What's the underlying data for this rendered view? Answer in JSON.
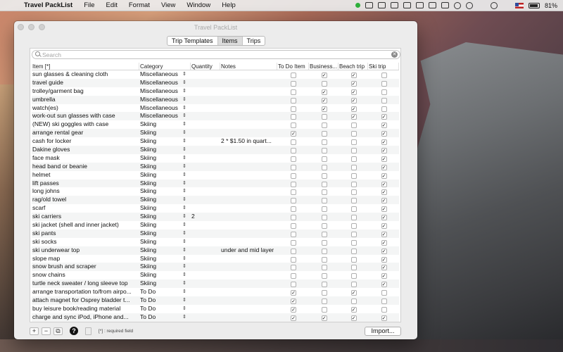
{
  "menubar": {
    "app_name": "Travel PackList",
    "menus": [
      "File",
      "Edit",
      "Format",
      "View",
      "Window",
      "Help"
    ],
    "battery": "81%"
  },
  "window": {
    "title": "Travel PackList",
    "tabs": [
      {
        "label": "Trip Templates",
        "active": false
      },
      {
        "label": "Items",
        "active": true
      },
      {
        "label": "Trips",
        "active": false
      }
    ],
    "search_placeholder": "Search",
    "columns": [
      "Item [*]",
      "Category",
      "Quantity",
      "Notes",
      "To Do Item",
      "Business...",
      "Beach trip",
      "Ski trip"
    ],
    "rows": [
      {
        "item": "sun glasses & cleaning cloth",
        "category": "Miscellaneous",
        "quantity": "",
        "notes": "",
        "todo": false,
        "business": true,
        "beach": true,
        "ski": false
      },
      {
        "item": "travel guide",
        "category": "Miscellaneous",
        "quantity": "",
        "notes": "",
        "todo": false,
        "business": false,
        "beach": true,
        "ski": false
      },
      {
        "item": "trolley/garment bag",
        "category": "Miscellaneous",
        "quantity": "",
        "notes": "",
        "todo": false,
        "business": true,
        "beach": true,
        "ski": false
      },
      {
        "item": "umbrella",
        "category": "Miscellaneous",
        "quantity": "",
        "notes": "",
        "todo": false,
        "business": true,
        "beach": true,
        "ski": false
      },
      {
        "item": "watch(es)",
        "category": "Miscellaneous",
        "quantity": "",
        "notes": "",
        "todo": false,
        "business": true,
        "beach": true,
        "ski": false
      },
      {
        "item": "work-out sun glasses with case",
        "category": "Miscellaneous",
        "quantity": "",
        "notes": "",
        "todo": false,
        "business": false,
        "beach": true,
        "ski": true
      },
      {
        "item": "(NEW) ski goggles with case",
        "category": "Skiing",
        "quantity": "",
        "notes": "",
        "todo": false,
        "business": false,
        "beach": false,
        "ski": true
      },
      {
        "item": "arrange rental gear",
        "category": "Skiing",
        "quantity": "",
        "notes": "",
        "todo": true,
        "business": false,
        "beach": false,
        "ski": true
      },
      {
        "item": "cash for locker",
        "category": "Skiing",
        "quantity": "",
        "notes": "2 * $1.50 in quart...",
        "todo": false,
        "business": false,
        "beach": false,
        "ski": true
      },
      {
        "item": "Dakine gloves",
        "category": "Skiing",
        "quantity": "",
        "notes": "",
        "todo": false,
        "business": false,
        "beach": false,
        "ski": true
      },
      {
        "item": "face mask",
        "category": "Skiing",
        "quantity": "",
        "notes": "",
        "todo": false,
        "business": false,
        "beach": false,
        "ski": true
      },
      {
        "item": "head band or beanie",
        "category": "Skiing",
        "quantity": "",
        "notes": "",
        "todo": false,
        "business": false,
        "beach": false,
        "ski": true
      },
      {
        "item": "helmet",
        "category": "Skiing",
        "quantity": "",
        "notes": "",
        "todo": false,
        "business": false,
        "beach": false,
        "ski": true
      },
      {
        "item": "lift passes",
        "category": "Skiing",
        "quantity": "",
        "notes": "",
        "todo": false,
        "business": false,
        "beach": false,
        "ski": true
      },
      {
        "item": "long johns",
        "category": "Skiing",
        "quantity": "",
        "notes": "",
        "todo": false,
        "business": false,
        "beach": false,
        "ski": true
      },
      {
        "item": "rag/old towel",
        "category": "Skiing",
        "quantity": "",
        "notes": "",
        "todo": false,
        "business": false,
        "beach": false,
        "ski": true
      },
      {
        "item": "scarf",
        "category": "Skiing",
        "quantity": "",
        "notes": "",
        "todo": false,
        "business": false,
        "beach": false,
        "ski": true
      },
      {
        "item": "ski carriers",
        "category": "Skiing",
        "quantity": "2",
        "notes": "",
        "todo": false,
        "business": false,
        "beach": false,
        "ski": true
      },
      {
        "item": "ski jacket (shell and inner jacket)",
        "category": "Skiing",
        "quantity": "",
        "notes": "",
        "todo": false,
        "business": false,
        "beach": false,
        "ski": true
      },
      {
        "item": "ski pants",
        "category": "Skiing",
        "quantity": "",
        "notes": "",
        "todo": false,
        "business": false,
        "beach": false,
        "ski": true
      },
      {
        "item": "ski socks",
        "category": "Skiing",
        "quantity": "",
        "notes": "",
        "todo": false,
        "business": false,
        "beach": false,
        "ski": true
      },
      {
        "item": "ski underwear top",
        "category": "Skiing",
        "quantity": "",
        "notes": "under and mid layer",
        "todo": false,
        "business": false,
        "beach": false,
        "ski": true
      },
      {
        "item": "slope map",
        "category": "Skiing",
        "quantity": "",
        "notes": "",
        "todo": false,
        "business": false,
        "beach": false,
        "ski": true
      },
      {
        "item": "snow brush and scraper",
        "category": "Skiing",
        "quantity": "",
        "notes": "",
        "todo": false,
        "business": false,
        "beach": false,
        "ski": true
      },
      {
        "item": "snow chains",
        "category": "Skiing",
        "quantity": "",
        "notes": "",
        "todo": false,
        "business": false,
        "beach": false,
        "ski": true
      },
      {
        "item": "turtle neck sweater / long sleeve top",
        "category": "Skiing",
        "quantity": "",
        "notes": "",
        "todo": false,
        "business": false,
        "beach": false,
        "ski": true
      },
      {
        "item": "arrange transportation to/from airpo...",
        "category": "To Do",
        "quantity": "",
        "notes": "",
        "todo": true,
        "business": false,
        "beach": true,
        "ski": false
      },
      {
        "item": "attach magnet for Osprey bladder t...",
        "category": "To Do",
        "quantity": "",
        "notes": "",
        "todo": true,
        "business": false,
        "beach": false,
        "ski": false
      },
      {
        "item": "buy leisure book/reading material",
        "category": "To Do",
        "quantity": "",
        "notes": "",
        "todo": true,
        "business": false,
        "beach": true,
        "ski": false
      },
      {
        "item": "charge and sync iPod, iPhone and...",
        "category": "To Do",
        "quantity": "",
        "notes": "",
        "todo": true,
        "business": true,
        "beach": true,
        "ski": true
      }
    ],
    "required_note": "[*] : required field",
    "import_label": "Import..."
  }
}
